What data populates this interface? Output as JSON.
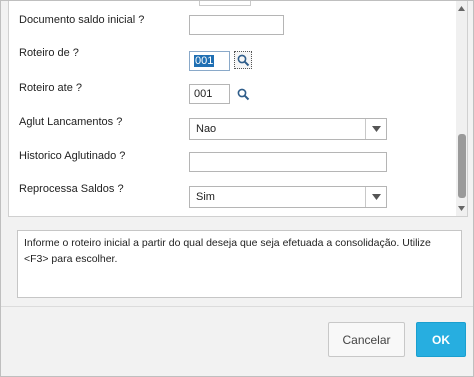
{
  "fields": [
    {
      "label": "Documento saldo inicial ?",
      "value": ""
    },
    {
      "label": "Roteiro de ?",
      "value": "001"
    },
    {
      "label": "Roteiro ate ?",
      "value": "001"
    },
    {
      "label": "Aglut Lancamentos ?",
      "value": "Nao"
    },
    {
      "label": "Historico Aglutinado ?",
      "value": ""
    },
    {
      "label": "Reprocessa Saldos ?",
      "value": "Sim"
    }
  ],
  "help_text": "Informe o roteiro inicial a partir do qual deseja que seja efetuada a consolidação. Utilize <F3> para escolher.",
  "buttons": {
    "cancel": "Cancelar",
    "ok": "OK"
  },
  "colors": {
    "ok_button": "#27aee0",
    "selection": "#1f6fb3"
  }
}
